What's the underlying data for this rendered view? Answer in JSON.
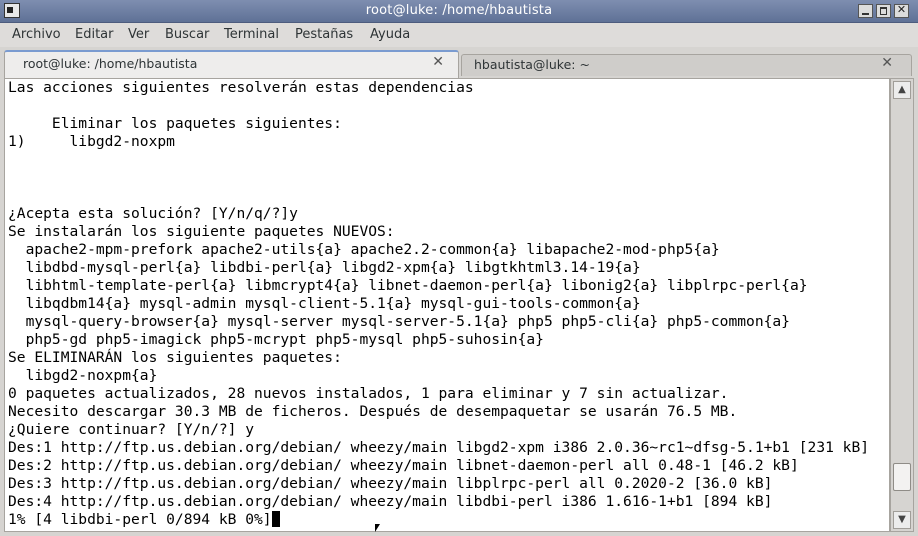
{
  "window": {
    "title": "root@luke: /home/hbautista"
  },
  "menu": [
    "Archivo",
    "Editar",
    "Ver",
    "Buscar",
    "Terminal",
    "Pestañas",
    "Ayuda"
  ],
  "tabs": [
    {
      "label": "root@luke: /home/hbautista",
      "active": true
    },
    {
      "label": "hbautista@luke: ~",
      "active": false
    }
  ],
  "terminal": {
    "lines": [
      "Las acciones siguientes resolverán estas dependencias",
      "",
      "     Eliminar los paquetes siguientes:",
      "1)     libgd2-noxpm",
      "",
      "",
      "",
      "¿Acepta esta solución? [Y/n/q/?]y",
      "Se instalarán los siguiente paquetes NUEVOS:",
      "  apache2-mpm-prefork apache2-utils{a} apache2.2-common{a} libapache2-mod-php5{a}",
      "  libdbd-mysql-perl{a} libdbi-perl{a} libgd2-xpm{a} libgtkhtml3.14-19{a}",
      "  libhtml-template-perl{a} libmcrypt4{a} libnet-daemon-perl{a} libonig2{a} libplrpc-perl{a}",
      "  libqdbm14{a} mysql-admin mysql-client-5.1{a} mysql-gui-tools-common{a}",
      "  mysql-query-browser{a} mysql-server mysql-server-5.1{a} php5 php5-cli{a} php5-common{a}",
      "  php5-gd php5-imagick php5-mcrypt php5-mysql php5-suhosin{a}",
      "Se ELIMINARÁN los siguientes paquetes:",
      "  libgd2-noxpm{a}",
      "0 paquetes actualizados, 28 nuevos instalados, 1 para eliminar y 7 sin actualizar.",
      "Necesito descargar 30.3 MB de ficheros. Después de desempaquetar se usarán 76.5 MB.",
      "¿Quiere continuar? [Y/n/?] y",
      "Des:1 http://ftp.us.debian.org/debian/ wheezy/main libgd2-xpm i386 2.0.36~rc1~dfsg-5.1+b1 [231 kB]",
      "Des:2 http://ftp.us.debian.org/debian/ wheezy/main libnet-daemon-perl all 0.48-1 [46.2 kB]",
      "Des:3 http://ftp.us.debian.org/debian/ wheezy/main libplrpc-perl all 0.2020-2 [36.0 kB]",
      "Des:4 http://ftp.us.debian.org/debian/ wheezy/main libdbi-perl i386 1.616-1+b1 [894 kB]"
    ],
    "prompt_line": "1% [4 libdbi-perl 0/894 kB 0%]"
  },
  "icons": {
    "app": "terminal-icon",
    "minimize": "minimize-icon",
    "maximize": "maximize-icon",
    "close": "close-icon"
  }
}
